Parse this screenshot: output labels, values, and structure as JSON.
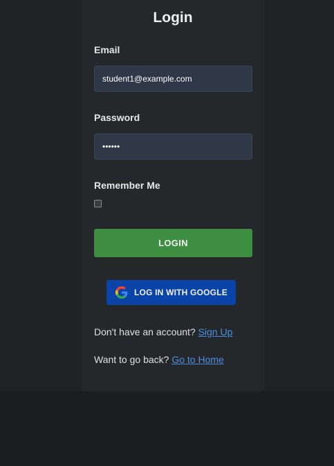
{
  "form": {
    "title": "Login",
    "email_label": "Email",
    "email_value": "student1@example.com",
    "password_label": "Password",
    "password_value": "••••••",
    "remember_label": "Remember Me",
    "remember_checked": false,
    "login_button": "LOGIN",
    "google_button": "LOG IN WITH GOOGLE"
  },
  "footer": {
    "signup_prompt": "Don't have an account?",
    "signup_link": "Sign Up",
    "home_prompt": "Want to go back?",
    "home_link": "Go to Home"
  },
  "colors": {
    "login_button": "#3e8e41",
    "google_button": "#0b44a8",
    "link": "#4a90e2"
  }
}
